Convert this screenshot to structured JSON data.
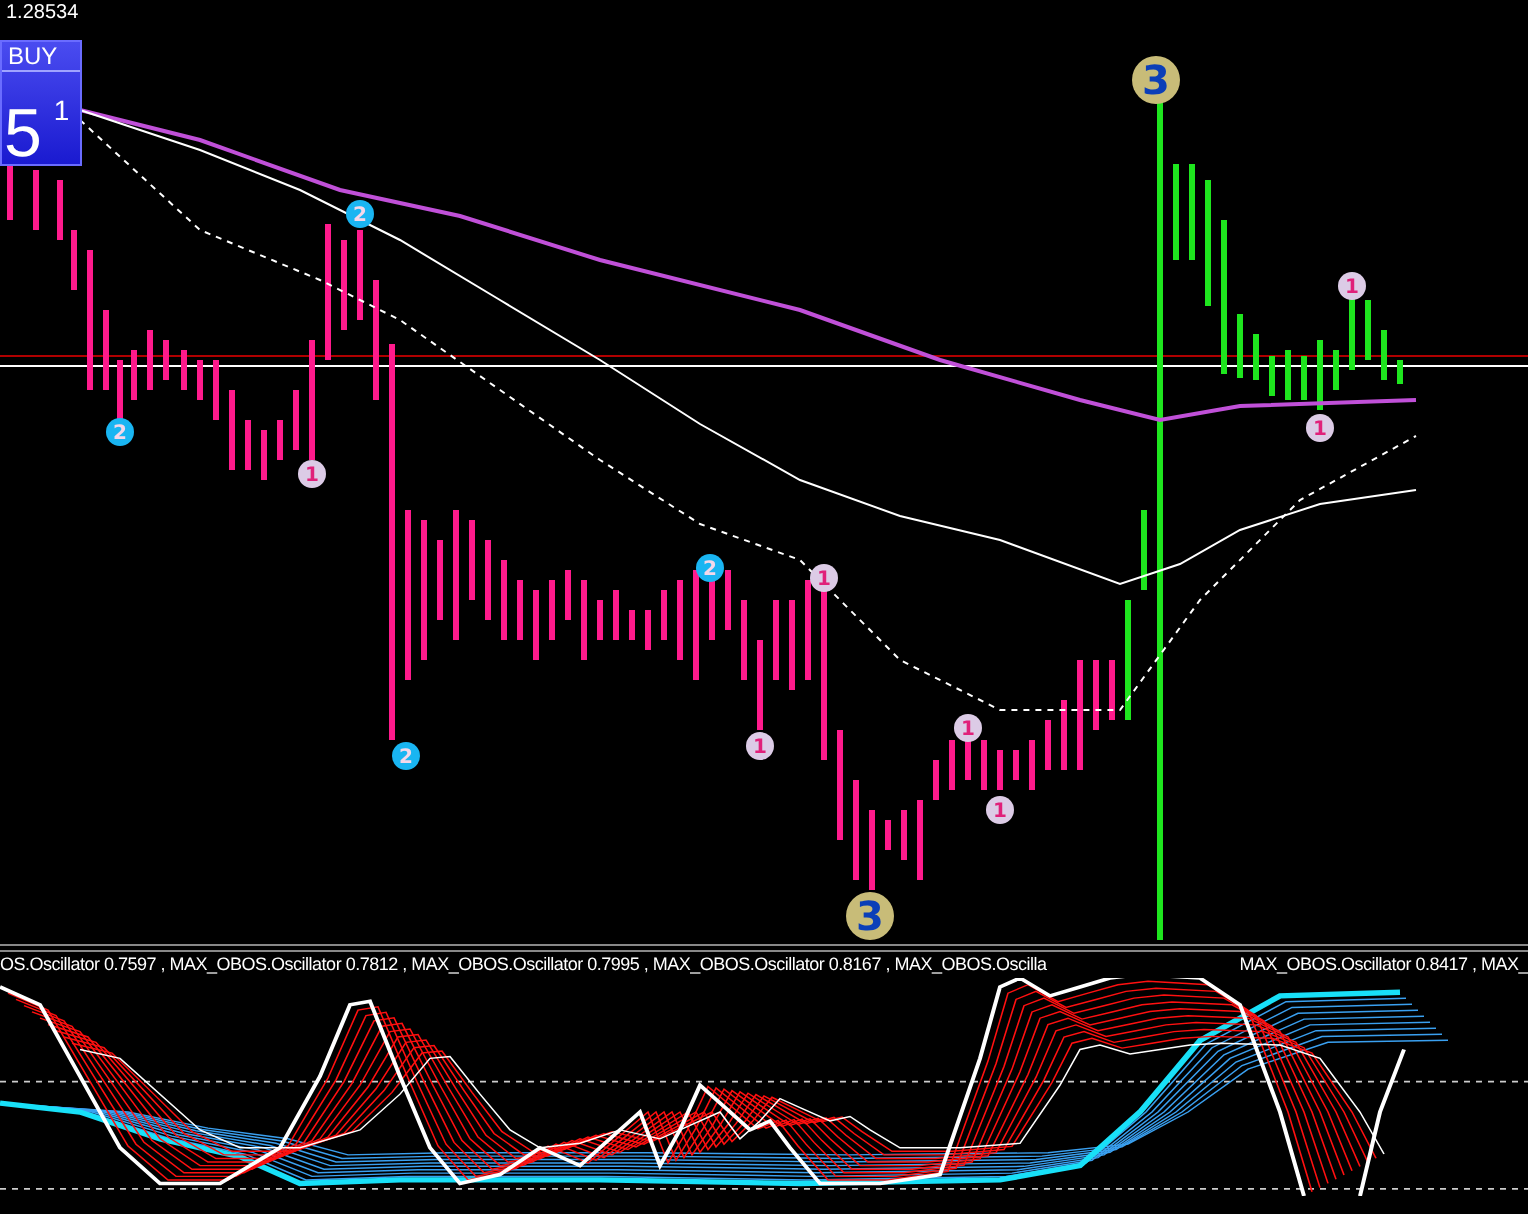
{
  "price_label": "1.28534",
  "trade_panel": {
    "action": "BUY",
    "lot": "5",
    "lot_fraction": "1"
  },
  "markers": [
    {
      "label": "2",
      "kind": "signal",
      "color": "#19b5f2"
    },
    {
      "label": "1",
      "kind": "signal",
      "color": "#dccbe6"
    },
    {
      "label": "2",
      "kind": "signal",
      "color": "#19b5f2"
    },
    {
      "label": "2",
      "kind": "signal",
      "color": "#19b5f2"
    },
    {
      "label": "2",
      "kind": "signal",
      "color": "#19b5f2"
    },
    {
      "label": "1",
      "kind": "signal",
      "color": "#dccbe6"
    },
    {
      "label": "1",
      "kind": "signal",
      "color": "#dccbe6"
    },
    {
      "label": "3",
      "kind": "major",
      "color": "#c8bc78"
    },
    {
      "label": "1",
      "kind": "signal",
      "color": "#dccbe6"
    },
    {
      "label": "1",
      "kind": "signal",
      "color": "#dccbe6"
    },
    {
      "label": "3",
      "kind": "major",
      "color": "#c8bc78"
    },
    {
      "label": "1",
      "kind": "signal",
      "color": "#dccbe6"
    },
    {
      "label": "1",
      "kind": "signal",
      "color": "#dccbe6"
    }
  ],
  "oscillator": {
    "labels": [
      "OS.Oscillator 0.7597 , MAX_OBOS.Oscillator 0.7812 , MAX_OBOS.Oscillator 0.7995 , MAX_OBOS.Oscillator 0.8167 , MAX_OBOS.Oscilla",
      "MAX_OBOS.Oscillator 0.8417 , MAX_"
    ]
  }
}
